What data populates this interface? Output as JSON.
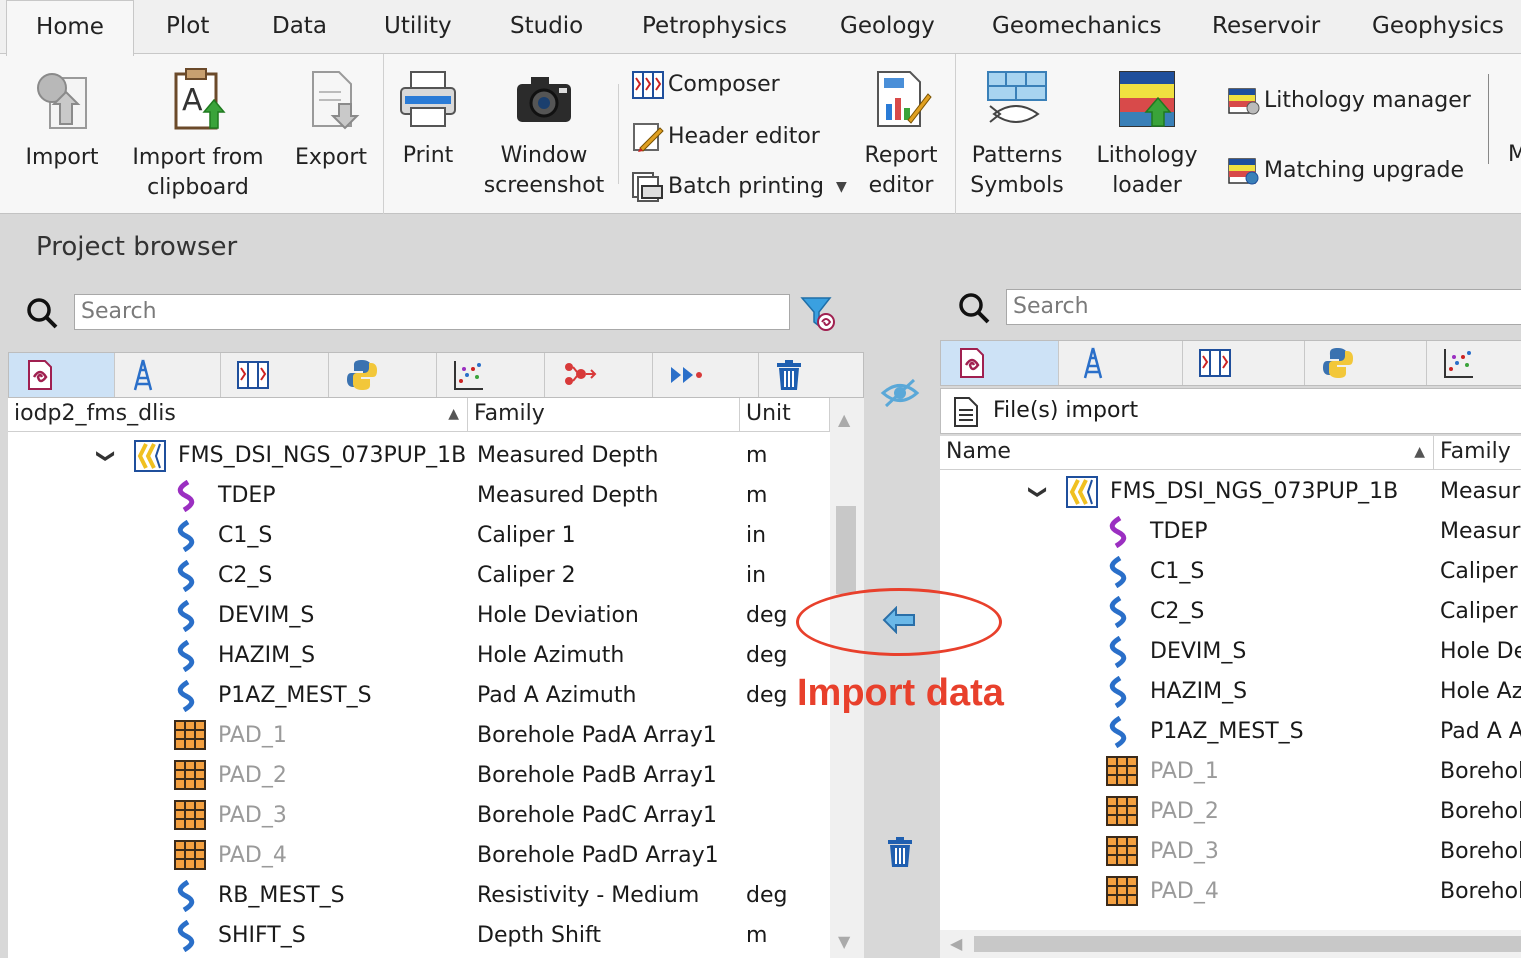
{
  "tabs": [
    "Home",
    "Plot",
    "Data",
    "Utility",
    "Studio",
    "Petrophysics",
    "Geology",
    "Geomechanics",
    "Reservoir",
    "Geophysics"
  ],
  "ribbon": {
    "import": "Import",
    "import_clip_1": "Import from",
    "import_clip_2": "clipboard",
    "export": "Export",
    "print": "Print",
    "window_1": "Window",
    "window_2": "screenshot",
    "composer": "Composer",
    "header_editor": "Header editor",
    "batch_printing": "Batch printing",
    "report_1": "Report",
    "report_2": "editor",
    "patterns_1": "Patterns",
    "patterns_2": "Symbols",
    "lith_1": "Lithology",
    "lith_2": "loader",
    "lith_manager": "Lithology manager",
    "matching_upgrade": "Matching upgrade",
    "cut_letter": "M"
  },
  "left": {
    "title": "Project browser",
    "search_placeholder": "Search",
    "col_name": "iodp2_fms_dlis",
    "col_family": "Family",
    "col_unit": "Unit",
    "group": {
      "name": "FMS_DSI_NGS_073PUP_1B",
      "family": "Measured Depth",
      "unit": "m"
    },
    "rows": [
      {
        "name": "TDEP",
        "family": "Measured Depth",
        "unit": "m",
        "kind": "depth"
      },
      {
        "name": "C1_S",
        "family": "Caliper 1",
        "unit": "in",
        "kind": "curve"
      },
      {
        "name": "C2_S",
        "family": "Caliper 2",
        "unit": "in",
        "kind": "curve"
      },
      {
        "name": "DEVIM_S",
        "family": "Hole Deviation",
        "unit": "deg",
        "kind": "curve"
      },
      {
        "name": "HAZIM_S",
        "family": "Hole Azimuth",
        "unit": "deg",
        "kind": "curve"
      },
      {
        "name": "P1AZ_MEST_S",
        "family": "Pad A Azimuth",
        "unit": "deg",
        "kind": "curve"
      },
      {
        "name": "PAD_1",
        "family": "Borehole PadA Array1",
        "unit": "",
        "kind": "array"
      },
      {
        "name": "PAD_2",
        "family": "Borehole PadB Array1",
        "unit": "",
        "kind": "array"
      },
      {
        "name": "PAD_3",
        "family": "Borehole PadC Array1",
        "unit": "",
        "kind": "array"
      },
      {
        "name": "PAD_4",
        "family": "Borehole PadD Array1",
        "unit": "",
        "kind": "array"
      },
      {
        "name": "RB_MEST_S",
        "family": "Resistivity - Medium",
        "unit": "deg",
        "kind": "curve"
      },
      {
        "name": "SHIFT_S",
        "family": "Depth Shift",
        "unit": "m",
        "kind": "curve"
      }
    ]
  },
  "annotation": "Import data",
  "right": {
    "search_placeholder": "Search",
    "file_import": "File(s) import",
    "col_name": "Name",
    "col_family": "Family",
    "group": {
      "name": "FMS_DSI_NGS_073PUP_1B",
      "family": "Measure"
    },
    "rows": [
      {
        "name": "TDEP",
        "family": "Measure",
        "kind": "depth"
      },
      {
        "name": "C1_S",
        "family": "Caliper",
        "kind": "curve"
      },
      {
        "name": "C2_S",
        "family": "Caliper :",
        "kind": "curve"
      },
      {
        "name": "DEVIM_S",
        "family": "Hole De",
        "kind": "curve"
      },
      {
        "name": "HAZIM_S",
        "family": "Hole Az",
        "kind": "curve"
      },
      {
        "name": "P1AZ_MEST_S",
        "family": "Pad A A",
        "kind": "curve"
      },
      {
        "name": "PAD_1",
        "family": "Borehol",
        "kind": "array"
      },
      {
        "name": "PAD_2",
        "family": "Borehol",
        "kind": "array"
      },
      {
        "name": "PAD_3",
        "family": "Borehol",
        "kind": "array"
      },
      {
        "name": "PAD_4",
        "family": "Borehol",
        "kind": "array"
      }
    ]
  },
  "colors": {
    "accent": "#cde2f6",
    "annotation": "#e8402c",
    "curve": "#2a6fc9",
    "depth": "#9b2fc1"
  }
}
